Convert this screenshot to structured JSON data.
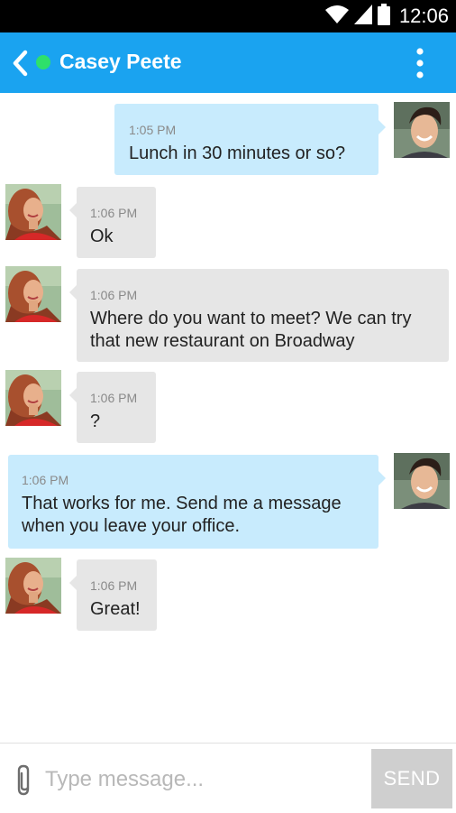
{
  "status_bar": {
    "time": "12:06"
  },
  "header": {
    "contact_name": "Casey Peete",
    "presence": "online"
  },
  "messages": [
    {
      "sender": "me",
      "time": "1:05 PM",
      "text": "Lunch in 30 minutes or so?"
    },
    {
      "sender": "contact",
      "time": "1:06 PM",
      "text": "Ok"
    },
    {
      "sender": "contact",
      "time": "1:06 PM",
      "text": "Where do you want to meet? We can try that new restaurant on Broadway"
    },
    {
      "sender": "contact",
      "time": "1:06 PM",
      "text": "?"
    },
    {
      "sender": "me",
      "time": "1:06 PM",
      "text": "That works for me. Send me a message when you leave your office."
    },
    {
      "sender": "contact",
      "time": "1:06 PM",
      "text": "Great!"
    }
  ],
  "composer": {
    "placeholder": "Type message...",
    "send_label": "SEND"
  },
  "icons": {
    "wifi": "wifi-icon",
    "signal": "signal-icon",
    "battery": "battery-icon",
    "back": "chevron-left-icon",
    "menu": "more-vertical-icon",
    "attach": "paperclip-icon"
  },
  "colors": {
    "app_bar": "#1aa3f0",
    "presence": "#2ee06b",
    "incoming_bubble": "#e6e6e6",
    "outgoing_bubble": "#c8ebfd",
    "send_button": "#cfcfcf"
  }
}
